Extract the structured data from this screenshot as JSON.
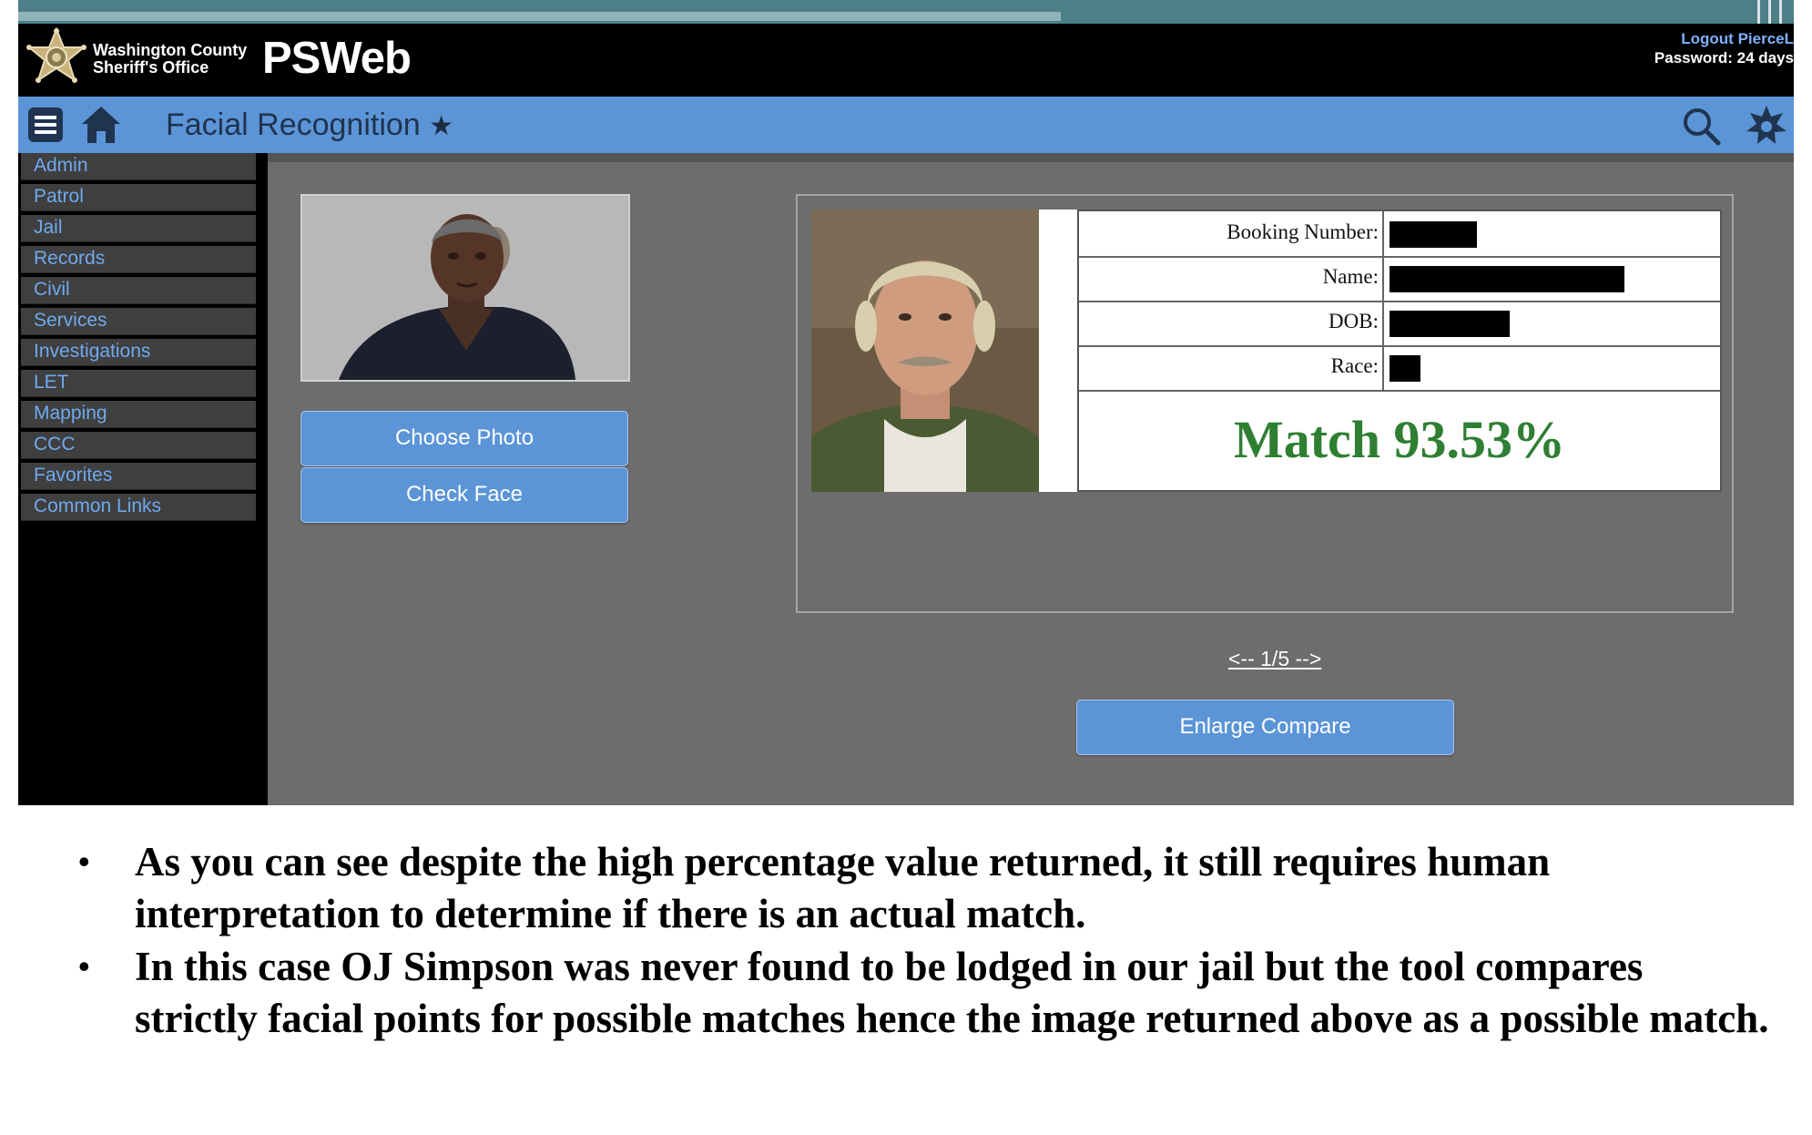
{
  "header": {
    "agency_line1": "Washington County",
    "agency_line2": "Sheriff's Office",
    "brand": "PSWeb",
    "logout_label": "Logout PierceL",
    "password_note": "Password: 24 days"
  },
  "navbar": {
    "title": "Facial Recognition",
    "title_star": "★",
    "icons": [
      "menu-icon",
      "home-icon",
      "search-icon",
      "sheriff-star-icon"
    ],
    "bar_color": "#5b95d7"
  },
  "sidebar": {
    "items": [
      {
        "label": "Admin"
      },
      {
        "label": "Patrol"
      },
      {
        "label": "Jail"
      },
      {
        "label": "Records"
      },
      {
        "label": "Civil"
      },
      {
        "label": "Services"
      },
      {
        "label": "Investigations"
      },
      {
        "label": "LET"
      },
      {
        "label": "Mapping"
      },
      {
        "label": "CCC"
      },
      {
        "label": "Favorites"
      },
      {
        "label": "Common Links"
      }
    ]
  },
  "probe": {
    "choose_label": "Choose Photo",
    "check_label": "Check Face"
  },
  "result": {
    "fields": [
      {
        "label": "Booking Number:",
        "value": "[redacted]"
      },
      {
        "label": "Name:",
        "value": "[redacted]"
      },
      {
        "label": "DOB:",
        "value": "[redacted]"
      },
      {
        "label": "Race:",
        "value": "[redacted]"
      }
    ],
    "match_text": "Match 93.53%",
    "match_color": "#2f7f33",
    "pager_prev": "<--",
    "pager_position": "1/5",
    "pager_next": "-->",
    "enlarge_label": "Enlarge Compare"
  },
  "notes": {
    "items": [
      "As you can see despite the high percentage value returned, it still requires human interpretation to determine if there is an actual match.",
      "In this case OJ Simpson was never found to be lodged in our jail but the tool compares strictly facial points for possible matches hence the image returned above as a possible match."
    ]
  }
}
